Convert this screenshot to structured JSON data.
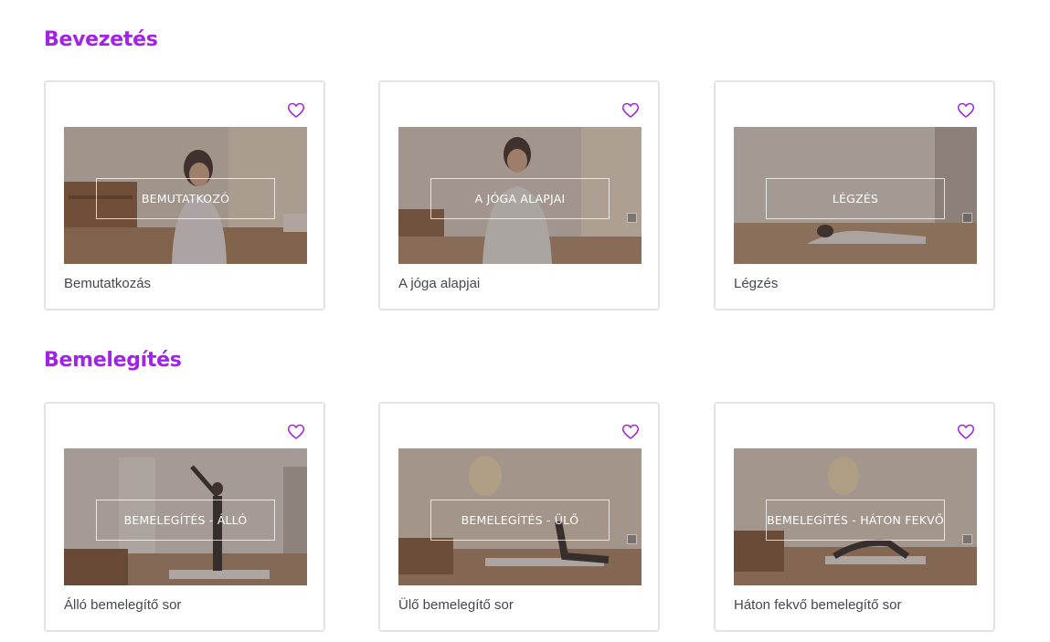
{
  "sections": [
    {
      "title": "Bevezetés",
      "cards": [
        {
          "overlay": "BEMUTATKOZÓ",
          "caption": "Bemutatkozás"
        },
        {
          "overlay": "A JÓGA ALAPJAI",
          "caption": "A jóga alapjai"
        },
        {
          "overlay": "LÉGZÉS",
          "caption": "Légzés"
        }
      ]
    },
    {
      "title": "Bemelegítés",
      "cards": [
        {
          "overlay": "BEMELEGÍTÉS - ÁLLÓ",
          "caption": "Álló bemelegítő sor"
        },
        {
          "overlay": "BEMELEGÍTÉS - ÜLŐ",
          "caption": "Ülő bemelegítő sor"
        },
        {
          "overlay": "BEMELEGÍTÉS - HÁTON FEKVŐ",
          "caption": "Háton fekvő bemelegítő sor"
        }
      ]
    }
  ],
  "icons": {
    "favorite": "heart-outline-icon",
    "expand": "expand-icon"
  },
  "colors": {
    "accent": "#a023e6",
    "card_border": "#e3e3e6",
    "caption_text": "#44474d"
  }
}
